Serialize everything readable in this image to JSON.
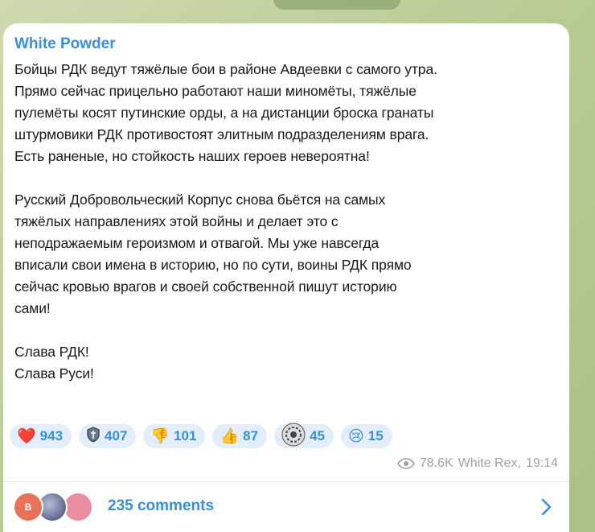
{
  "post": {
    "author": "White Powder",
    "paragraphs": [
      [
        "Бойцы РДК ведут тяжёлые бои в районе Авдеевки с самого утра.",
        "Прямо сейчас прицельно работают наши миномёты, тяжёлые",
        "пулемёты косят путинские орды, а на дистанции броска гранаты",
        "штурмовики РДК противостоят элитным подразделениям врага.",
        "Есть раненые, но стойкость наших героев невероятна!"
      ],
      [
        "Русский Добровольческий Корпус снова бьётся на самых",
        "тяжёлых направлениях этой войны и делает это с",
        "неподражаемым героизмом и отвагой. Мы уже навсегда",
        "вписали свои имена в историю, но по сути, воины РДК прямо",
        "сейчас кровью врагов и своей собственной пишут историю",
        "сами!"
      ],
      [
        "Слава РДК!",
        "Слава Руси!"
      ]
    ]
  },
  "reactions": [
    {
      "emoji": "❤️",
      "icon": "red-heart-icon",
      "count": "943"
    },
    {
      "emoji": "🛡",
      "icon": "shield-icon",
      "count": "407"
    },
    {
      "emoji": "👎",
      "icon": "thumbs-down-icon",
      "count": "101"
    },
    {
      "emoji": "👍",
      "icon": "thumbs-up-icon",
      "count": "87"
    },
    {
      "emoji": "⚙",
      "icon": "custom-emoji-icon",
      "count": "45"
    },
    {
      "emoji": "😢",
      "icon": "crying-face-icon",
      "count": "15"
    }
  ],
  "meta": {
    "views": "78.6K",
    "signature": "White Rex,",
    "time": "19:14"
  },
  "comments": {
    "label": "235 comments",
    "first_avatar_letter": "B"
  },
  "colors": {
    "accent": "#3a8fd6",
    "reaction_bg": "#e4eefa",
    "meta": "#9aa3ab"
  }
}
